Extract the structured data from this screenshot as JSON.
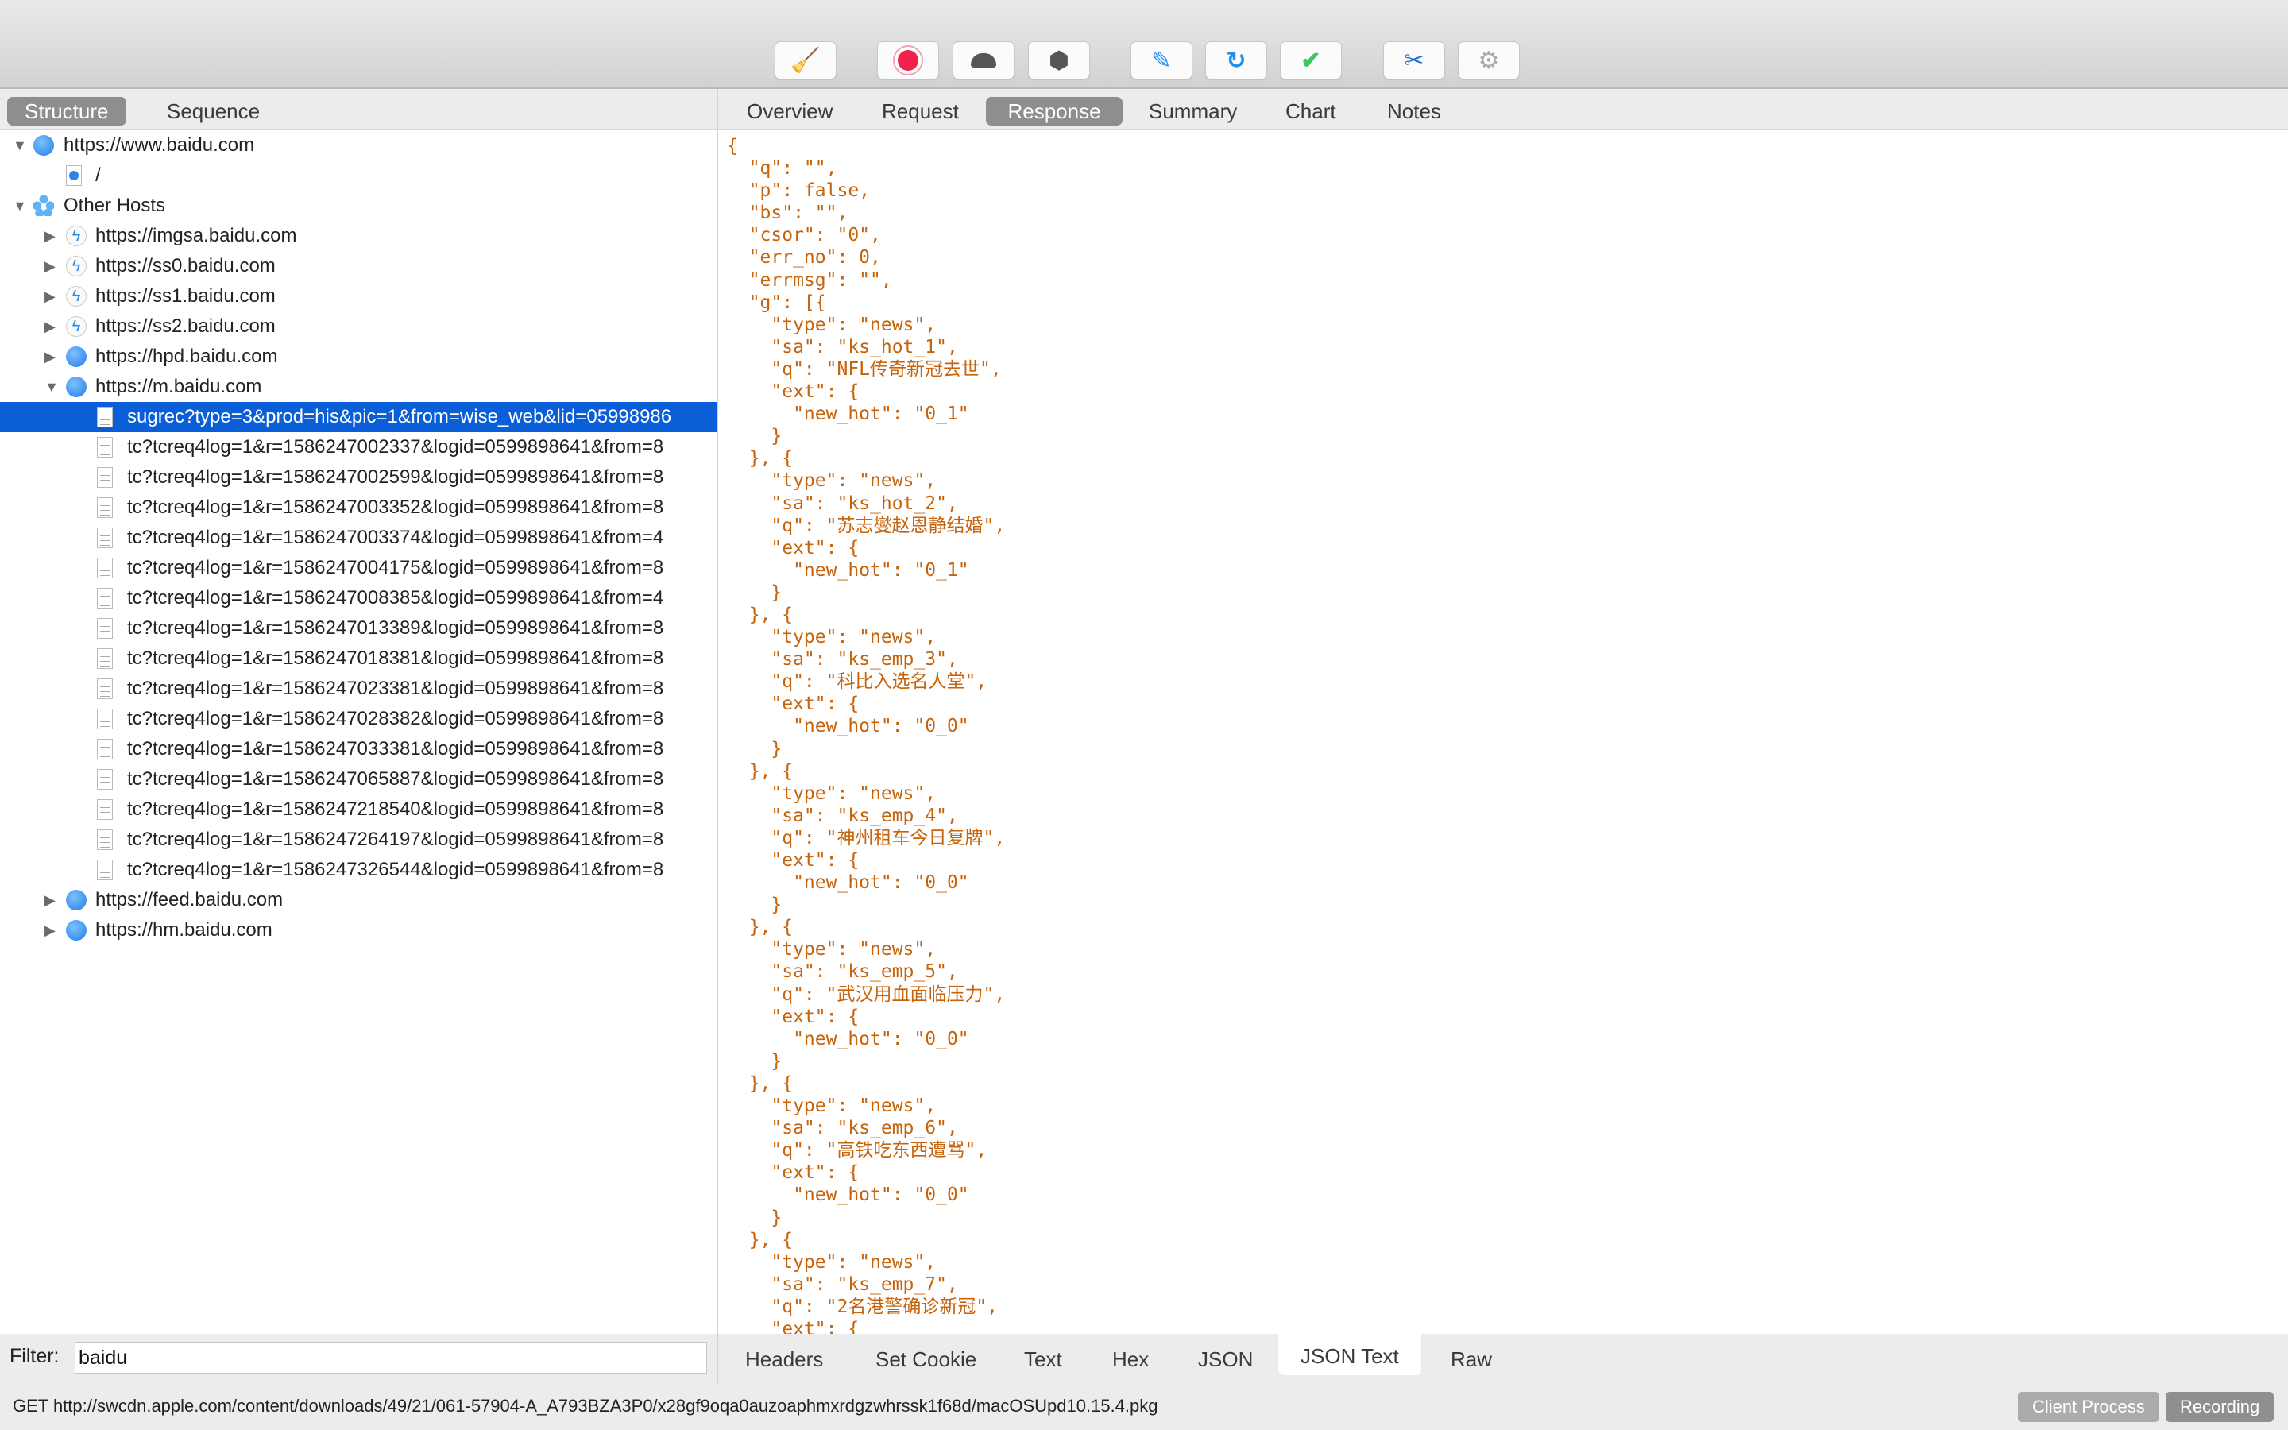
{
  "toolbar": {
    "buttons": [
      {
        "icon": "broom-icon",
        "label": "Clear"
      },
      {
        "icon": "record-icon",
        "label": "Record"
      },
      {
        "icon": "turtle-icon",
        "label": "Throttle"
      },
      {
        "icon": "breakpoint-stop-icon",
        "label": "Breakpoints"
      },
      {
        "icon": "pen-icon",
        "label": "Edit"
      },
      {
        "icon": "refresh-icon",
        "label": "Repeat"
      },
      {
        "icon": "checkmark-icon",
        "label": "Validate"
      },
      {
        "icon": "tools-icon",
        "label": "Tools"
      },
      {
        "icon": "gear-icon",
        "label": "Settings"
      }
    ]
  },
  "left_tabs": [
    {
      "label": "Structure",
      "selected": true
    },
    {
      "label": "Sequence",
      "selected": false
    }
  ],
  "right_tabs": [
    {
      "label": "Overview"
    },
    {
      "label": "Request"
    },
    {
      "label": "Response",
      "selected": true
    },
    {
      "label": "Summary"
    },
    {
      "label": "Chart"
    },
    {
      "label": "Notes"
    }
  ],
  "tree": [
    {
      "level": "root",
      "expanded": true,
      "icon": "globe",
      "label": "https://www.baidu.com"
    },
    {
      "level": "leaf1",
      "icon": "docg",
      "label": "/"
    },
    {
      "level": "root",
      "expanded": true,
      "icon": "cluster",
      "label": "Other Hosts"
    },
    {
      "level": "child",
      "expanded": false,
      "icon": "bolt",
      "label": "https://imgsa.baidu.com"
    },
    {
      "level": "child",
      "expanded": false,
      "icon": "bolt",
      "label": "https://ss0.baidu.com"
    },
    {
      "level": "child",
      "expanded": false,
      "icon": "bolt",
      "label": "https://ss1.baidu.com"
    },
    {
      "level": "child",
      "expanded": false,
      "icon": "bolt",
      "label": "https://ss2.baidu.com"
    },
    {
      "level": "child",
      "expanded": false,
      "icon": "globe",
      "label": "https://hpd.baidu.com"
    },
    {
      "level": "child",
      "expanded": true,
      "icon": "globe",
      "label": "https://m.baidu.com"
    },
    {
      "level": "leaf2",
      "icon": "doc",
      "selected": true,
      "label": "sugrec?type=3&prod=his&pic=1&from=wise_web&lid=05998986"
    },
    {
      "level": "leaf2",
      "icon": "doc",
      "label": "tc?tcreq4log=1&r=1586247002337&logid=0599898641&from=8"
    },
    {
      "level": "leaf2",
      "icon": "doc",
      "label": "tc?tcreq4log=1&r=1586247002599&logid=0599898641&from=8"
    },
    {
      "level": "leaf2",
      "icon": "doc",
      "label": "tc?tcreq4log=1&r=1586247003352&logid=0599898641&from=8"
    },
    {
      "level": "leaf2",
      "icon": "doc",
      "label": "tc?tcreq4log=1&r=1586247003374&logid=0599898641&from=4"
    },
    {
      "level": "leaf2",
      "icon": "doc",
      "label": "tc?tcreq4log=1&r=1586247004175&logid=0599898641&from=8"
    },
    {
      "level": "leaf2",
      "icon": "doc",
      "label": "tc?tcreq4log=1&r=1586247008385&logid=0599898641&from=4"
    },
    {
      "level": "leaf2",
      "icon": "doc",
      "label": "tc?tcreq4log=1&r=1586247013389&logid=0599898641&from=8"
    },
    {
      "level": "leaf2",
      "icon": "doc",
      "label": "tc?tcreq4log=1&r=1586247018381&logid=0599898641&from=8"
    },
    {
      "level": "leaf2",
      "icon": "doc",
      "label": "tc?tcreq4log=1&r=1586247023381&logid=0599898641&from=8"
    },
    {
      "level": "leaf2",
      "icon": "doc",
      "label": "tc?tcreq4log=1&r=1586247028382&logid=0599898641&from=8"
    },
    {
      "level": "leaf2",
      "icon": "doc",
      "label": "tc?tcreq4log=1&r=1586247033381&logid=0599898641&from=8"
    },
    {
      "level": "leaf2",
      "icon": "doc",
      "label": "tc?tcreq4log=1&r=1586247065887&logid=0599898641&from=8"
    },
    {
      "level": "leaf2",
      "icon": "doc",
      "label": "tc?tcreq4log=1&r=1586247218540&logid=0599898641&from=8"
    },
    {
      "level": "leaf2",
      "icon": "doc",
      "label": "tc?tcreq4log=1&r=1586247264197&logid=0599898641&from=8"
    },
    {
      "level": "leaf2",
      "icon": "doc",
      "label": "tc?tcreq4log=1&r=1586247326544&logid=0599898641&from=8"
    },
    {
      "level": "child",
      "expanded": false,
      "icon": "globe",
      "label": "https://feed.baidu.com"
    },
    {
      "level": "child",
      "expanded": false,
      "icon": "globe",
      "label": "https://hm.baidu.com"
    }
  ],
  "response_json_lines": [
    "{",
    "  \"q\": \"\",",
    "  \"p\": false,",
    "  \"bs\": \"\",",
    "  \"csor\": \"0\",",
    "  \"err_no\": 0,",
    "  \"errmsg\": \"\",",
    "  \"g\": [{",
    "    \"type\": \"news\",",
    "    \"sa\": \"ks_hot_1\",",
    "    \"q\": \"NFL传奇新冠去世\",",
    "    \"ext\": {",
    "      \"new_hot\": \"0_1\"",
    "    }",
    "  }, {",
    "    \"type\": \"news\",",
    "    \"sa\": \"ks_hot_2\",",
    "    \"q\": \"苏志燮赵恩静结婚\",",
    "    \"ext\": {",
    "      \"new_hot\": \"0_1\"",
    "    }",
    "  }, {",
    "    \"type\": \"news\",",
    "    \"sa\": \"ks_emp_3\",",
    "    \"q\": \"科比入选名人堂\",",
    "    \"ext\": {",
    "      \"new_hot\": \"0_0\"",
    "    }",
    "  }, {",
    "    \"type\": \"news\",",
    "    \"sa\": \"ks_emp_4\",",
    "    \"q\": \"神州租车今日复牌\",",
    "    \"ext\": {",
    "      \"new_hot\": \"0_0\"",
    "    }",
    "  }, {",
    "    \"type\": \"news\",",
    "    \"sa\": \"ks_emp_5\",",
    "    \"q\": \"武汉用血面临压力\",",
    "    \"ext\": {",
    "      \"new_hot\": \"0_0\"",
    "    }",
    "  }, {",
    "    \"type\": \"news\",",
    "    \"sa\": \"ks_emp_6\",",
    "    \"q\": \"高铁吃东西遭骂\",",
    "    \"ext\": {",
    "      \"new_hot\": \"0_0\"",
    "    }",
    "  }, {",
    "    \"type\": \"news\",",
    "    \"sa\": \"ks_emp_7\",",
    "    \"q\": \"2名港警确诊新冠\",",
    "    \"ext\": {"
  ],
  "filter": {
    "label": "Filter:",
    "value": "baidu"
  },
  "bottom_tabs": [
    {
      "label": "Headers"
    },
    {
      "label": "Set Cookie"
    },
    {
      "label": "Text"
    },
    {
      "label": "Hex"
    },
    {
      "label": "JSON"
    },
    {
      "label": "JSON Text",
      "selected": true
    },
    {
      "label": "Raw"
    }
  ],
  "status": {
    "text": "GET http://swcdn.apple.com/content/downloads/49/21/061-57904-A_A793BZA3P0/x28gf9oqa0auzoaphmxrdgzwhrssk1f68d/macOSUpd10.15.4.pkg",
    "client_process_label": "Client Process",
    "recording_label": "Recording"
  },
  "colors": {
    "selection": "#0a5fd8",
    "json_string": "#c6630b",
    "json_boolean": "#2b2bff",
    "json_number": "#7c8a12"
  }
}
